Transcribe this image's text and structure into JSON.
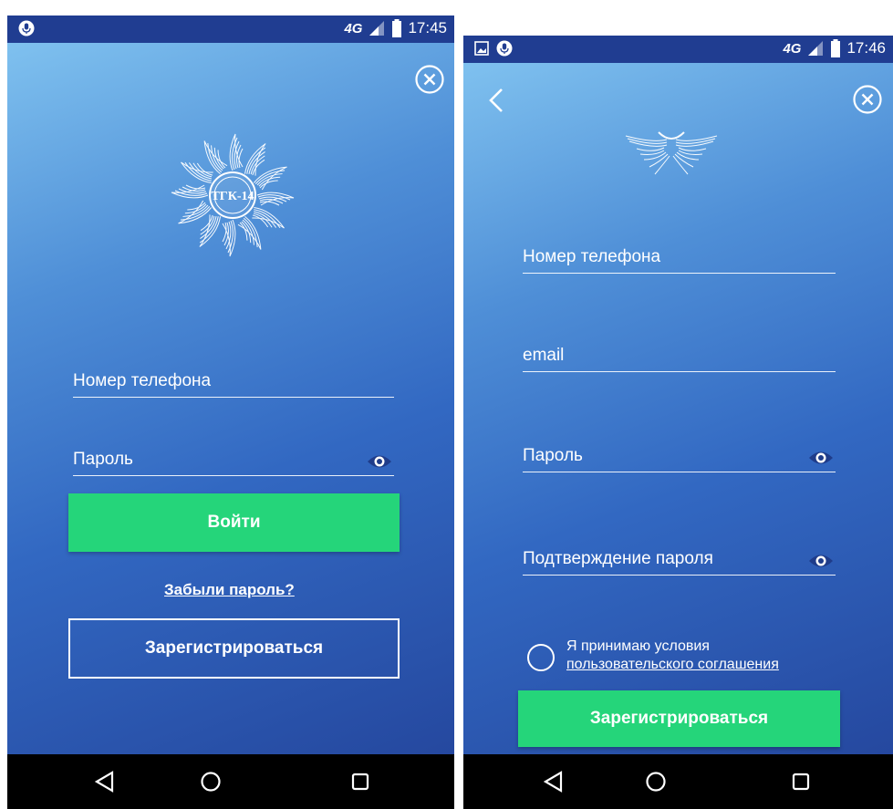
{
  "login_screen": {
    "status": {
      "network": "4G",
      "time": "17:45"
    },
    "logo_text": "ТГК-14",
    "phone_placeholder": "Номер телефона",
    "password_placeholder": "Пароль",
    "login_button": "Войти",
    "forgot_link": "Забыли пароль?",
    "register_button": "Зарегистрироваться"
  },
  "register_screen": {
    "status": {
      "network": "4G",
      "time": "17:46"
    },
    "phone_placeholder": "Номер телефона",
    "email_placeholder": "email",
    "password_placeholder": "Пароль",
    "confirm_placeholder": "Подтверждение пароля",
    "terms_line1": "Я принимаю условия",
    "terms_link": "пользовательского соглашения",
    "terms_accepted": false,
    "register_button": "Зарегистрироваться"
  },
  "colors": {
    "statusbar": "#203d91",
    "accent_green": "#25d57a",
    "gradient_top": "#7fc1ef",
    "gradient_bottom": "#25489f"
  },
  "icons": [
    "mic-icon",
    "gallery-icon",
    "signal-icon",
    "battery-icon",
    "close-icon",
    "back-icon",
    "eye-icon",
    "nav-back-icon",
    "nav-home-icon",
    "nav-recents-icon"
  ]
}
